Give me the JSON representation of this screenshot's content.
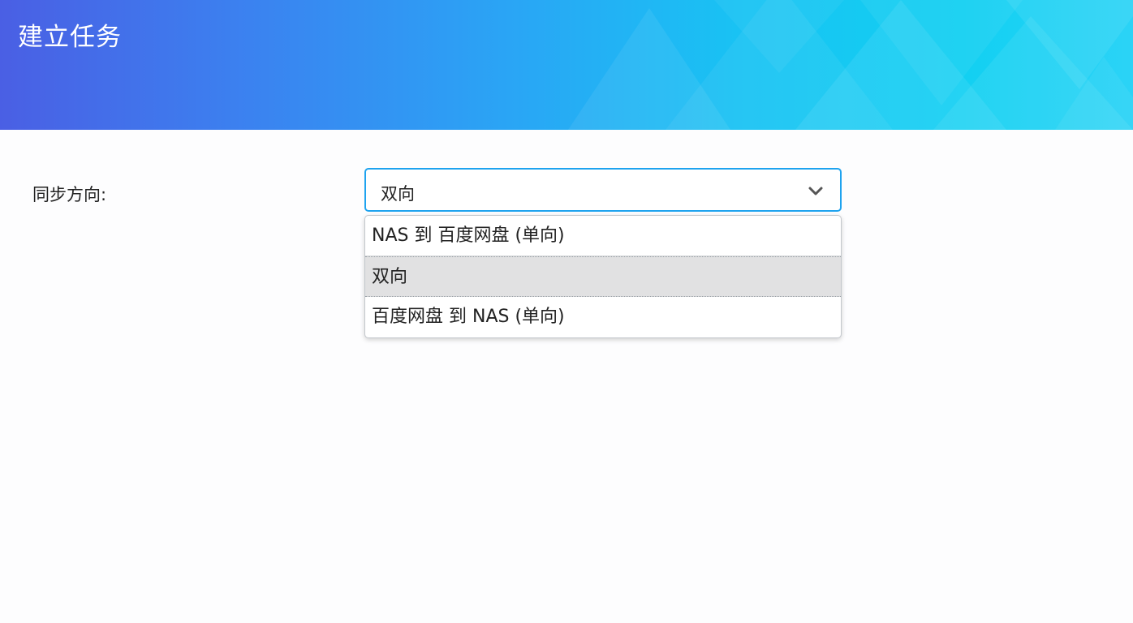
{
  "header": {
    "title": "建立任务",
    "gradient_colors": [
      "#4a5fe4",
      "#2aa5f5",
      "#12d0f2"
    ]
  },
  "form": {
    "sync_direction": {
      "label": "同步方向:",
      "selected_value": "双向",
      "border_color": "#1ea3ef",
      "options": [
        {
          "label": "NAS 到 百度网盘 (单向)",
          "selected": false
        },
        {
          "label": "双向",
          "selected": true
        },
        {
          "label": "百度网盘 到 NAS (单向)",
          "selected": false
        }
      ]
    }
  },
  "icons": {
    "dropdown_toggle": "chevron-down-icon"
  }
}
